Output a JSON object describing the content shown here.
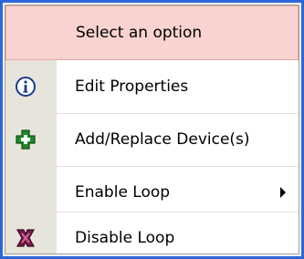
{
  "menu": {
    "header": {
      "label": "Select an option"
    },
    "items": [
      {
        "label": "Edit Properties",
        "icon": "info-icon"
      },
      {
        "label": "Add/Replace Device(s)",
        "icon": "add-cross-icon"
      },
      {
        "label": "Enable Loop",
        "icon": "submenu-arrow-icon"
      },
      {
        "label": "Disable Loop",
        "icon": "disable-loop-icon"
      }
    ]
  },
  "colors": {
    "header_bg": "#f9d3cf",
    "border_accent": "#2e66d9",
    "gutter_bg": "#e7e4db"
  }
}
